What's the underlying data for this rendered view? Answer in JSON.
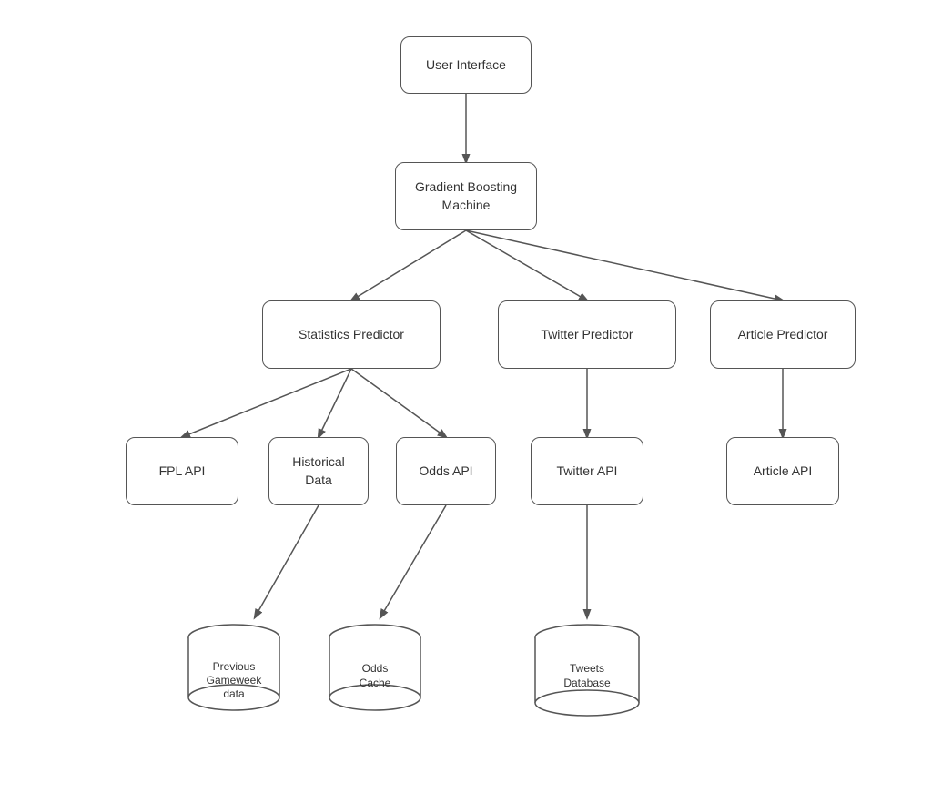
{
  "nodes": {
    "user_interface": {
      "label": "User Interface"
    },
    "gradient_boosting": {
      "label": "Gradient Boosting\nMachine"
    },
    "statistics_predictor": {
      "label": "Statistics Predictor"
    },
    "twitter_predictor": {
      "label": "Twitter Predictor"
    },
    "article_predictor": {
      "label": "Article Predictor"
    },
    "fpl_api": {
      "label": "FPL API"
    },
    "historical_data": {
      "label": "Historical\nData"
    },
    "odds_api": {
      "label": "Odds API"
    },
    "twitter_api": {
      "label": "Twitter API"
    },
    "article_api": {
      "label": "Article API"
    },
    "previous_gameweek": {
      "label": "Previous\nGameweek\ndata"
    },
    "odds_cache": {
      "label": "Odds\nCache"
    },
    "tweets_database": {
      "label": "Tweets\nDatabase"
    }
  }
}
